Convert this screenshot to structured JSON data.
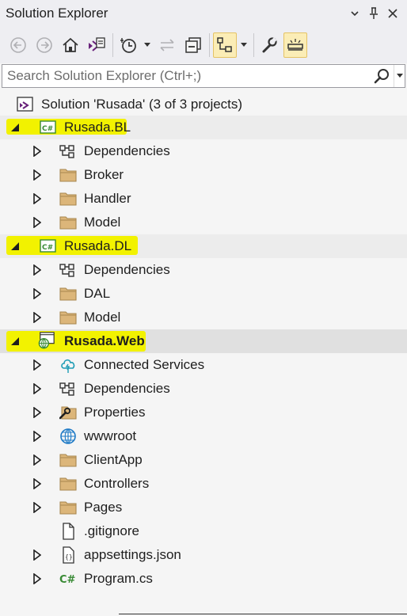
{
  "window": {
    "title": "Solution Explorer"
  },
  "title_buttons": {
    "dropdown": "▾",
    "pin": "📌",
    "close": "✕"
  },
  "search": {
    "placeholder": "Search Solution Explorer (Ctrl+;)"
  },
  "solution": {
    "label": "Solution 'Rusada' (3 of 3 projects)"
  },
  "projects": [
    {
      "name": "Rusada.BL",
      "children": [
        "Dependencies",
        "Broker",
        "Handler",
        "Model"
      ]
    },
    {
      "name": "Rusada.DL",
      "children": [
        "Dependencies",
        "DAL",
        "Model"
      ]
    },
    {
      "name": "Rusada.Web",
      "children": [
        "Connected Services",
        "Dependencies",
        "Properties",
        "wwwroot",
        "ClientApp",
        "Controllers",
        "Pages",
        ".gitignore",
        "appsettings.json",
        "Program.cs"
      ]
    }
  ],
  "colors": {
    "highlight": "#f2f200",
    "folder": "#dcb67a",
    "csharp": "#388a34",
    "vs_purple": "#68217a",
    "globe": "#1e7ac6"
  }
}
